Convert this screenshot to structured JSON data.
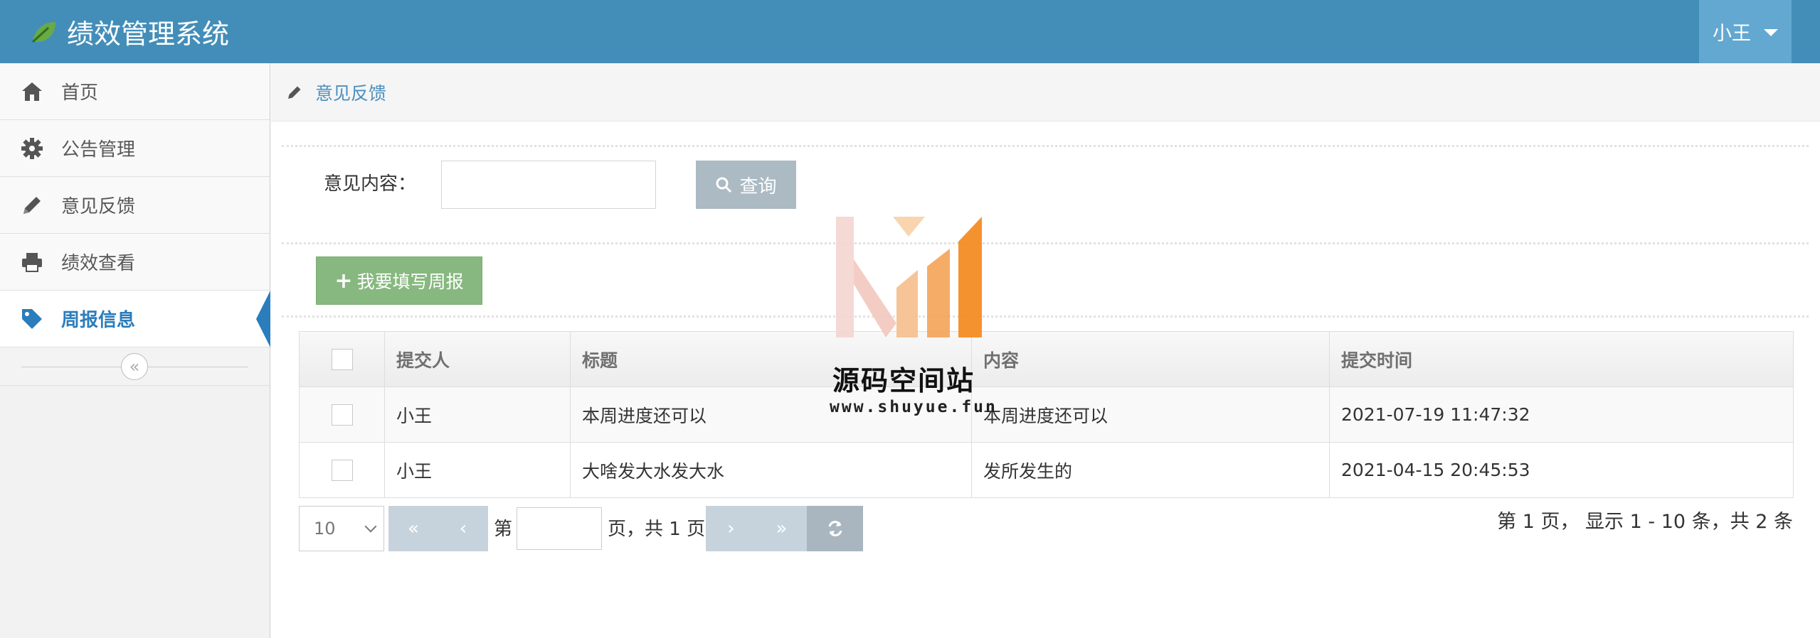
{
  "app": {
    "title": "绩效管理系统",
    "user_name": "小王"
  },
  "sidebar": {
    "items": [
      {
        "label": "首页",
        "icon": "home-icon"
      },
      {
        "label": "公告管理",
        "icon": "gear-icon"
      },
      {
        "label": "意见反馈",
        "icon": "pencil-icon"
      },
      {
        "label": "绩效查看",
        "icon": "print-icon"
      },
      {
        "label": "周报信息",
        "icon": "tag-icon",
        "active": true
      }
    ],
    "collapse_glyph": "«"
  },
  "breadcrumb": {
    "label": "意见反馈"
  },
  "search": {
    "label": "意见内容：",
    "value": "",
    "button_label": "查询"
  },
  "actions": {
    "add_label": "我要填写周报"
  },
  "table": {
    "headers": [
      "提交人",
      "标题",
      "内容",
      "提交时间"
    ],
    "rows": [
      {
        "submitter": "小王",
        "title": "本周进度还可以",
        "content": "本周进度还可以",
        "time": "2021-07-19 11:47:32"
      },
      {
        "submitter": "小王",
        "title": "大啥发大水发大水",
        "content": "发所发生的",
        "time": "2021-04-15 20:45:53"
      }
    ]
  },
  "pagination": {
    "page_size": "10",
    "first": "«",
    "prev": "‹",
    "next": "›",
    "last": "»",
    "page_prefix": "第",
    "page_input": "",
    "page_suffix": "页，共 1 页",
    "summary": "第 1 页， 显示 1 - 10 条，共 2 条"
  },
  "watermark": {
    "text": "源码空间站",
    "url": "www.shuyue.fun"
  },
  "colors": {
    "navbar": "#438eb9",
    "user_menu": "#62a8d1",
    "active_nav": "#2b7dbc",
    "query_button": "#abbac3",
    "add_button": "#87b87f",
    "pager_button": "#c7d3dc"
  }
}
